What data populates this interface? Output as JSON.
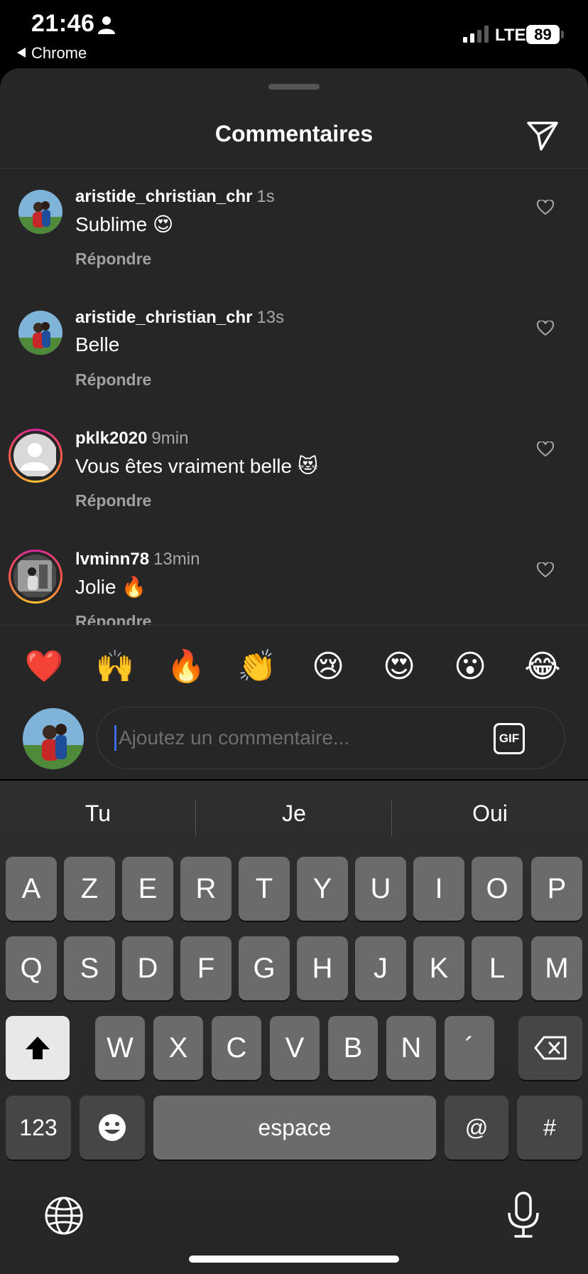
{
  "status_bar": {
    "time": "21:46",
    "back_app": "Chrome",
    "network": "LTE",
    "battery": "89"
  },
  "sheet": {
    "title": "Commentaires"
  },
  "comments": [
    {
      "user": "aristide_christian_chr",
      "time": "1s",
      "text": "Sublime 😍",
      "reply": "Répondre"
    },
    {
      "user": "aristide_christian_chr",
      "time": "13s",
      "text": "Belle",
      "reply": "Répondre"
    },
    {
      "user": "pklk2020",
      "time": "9min",
      "text": "Vous êtes vraiment belle 😻",
      "reply": "Répondre"
    },
    {
      "user": "lvminn78",
      "time": "13min",
      "text": "Jolie 🔥",
      "reply": "Répondre"
    }
  ],
  "reactions": [
    "❤️",
    "🙌",
    "🔥",
    "👏",
    "😢",
    "😍",
    "😮",
    "😂"
  ],
  "composer": {
    "placeholder": "Ajoutez un commentaire...",
    "gif": "GIF"
  },
  "keyboard": {
    "suggestions": [
      "Tu",
      "Je",
      "Oui"
    ],
    "row1": [
      "A",
      "Z",
      "E",
      "R",
      "T",
      "Y",
      "U",
      "I",
      "O",
      "P"
    ],
    "row2": [
      "Q",
      "S",
      "D",
      "F",
      "G",
      "H",
      "J",
      "K",
      "L",
      "M"
    ],
    "row3": [
      "W",
      "X",
      "C",
      "V",
      "B",
      "N",
      "´"
    ],
    "numbers": "123",
    "space": "espace",
    "at": "@",
    "hash": "#"
  },
  "icons": {
    "person": "person-icon",
    "send": "paper-plane-icon",
    "heart": "heart-outline-icon",
    "shift": "shift-icon",
    "delete": "backspace-icon",
    "emoji": "emoji-icon",
    "globe": "globe-icon",
    "mic": "microphone-icon"
  },
  "colors": {
    "background": "#262626",
    "accent_caret": "#3d6df0",
    "story_ring": "#d6249f"
  }
}
